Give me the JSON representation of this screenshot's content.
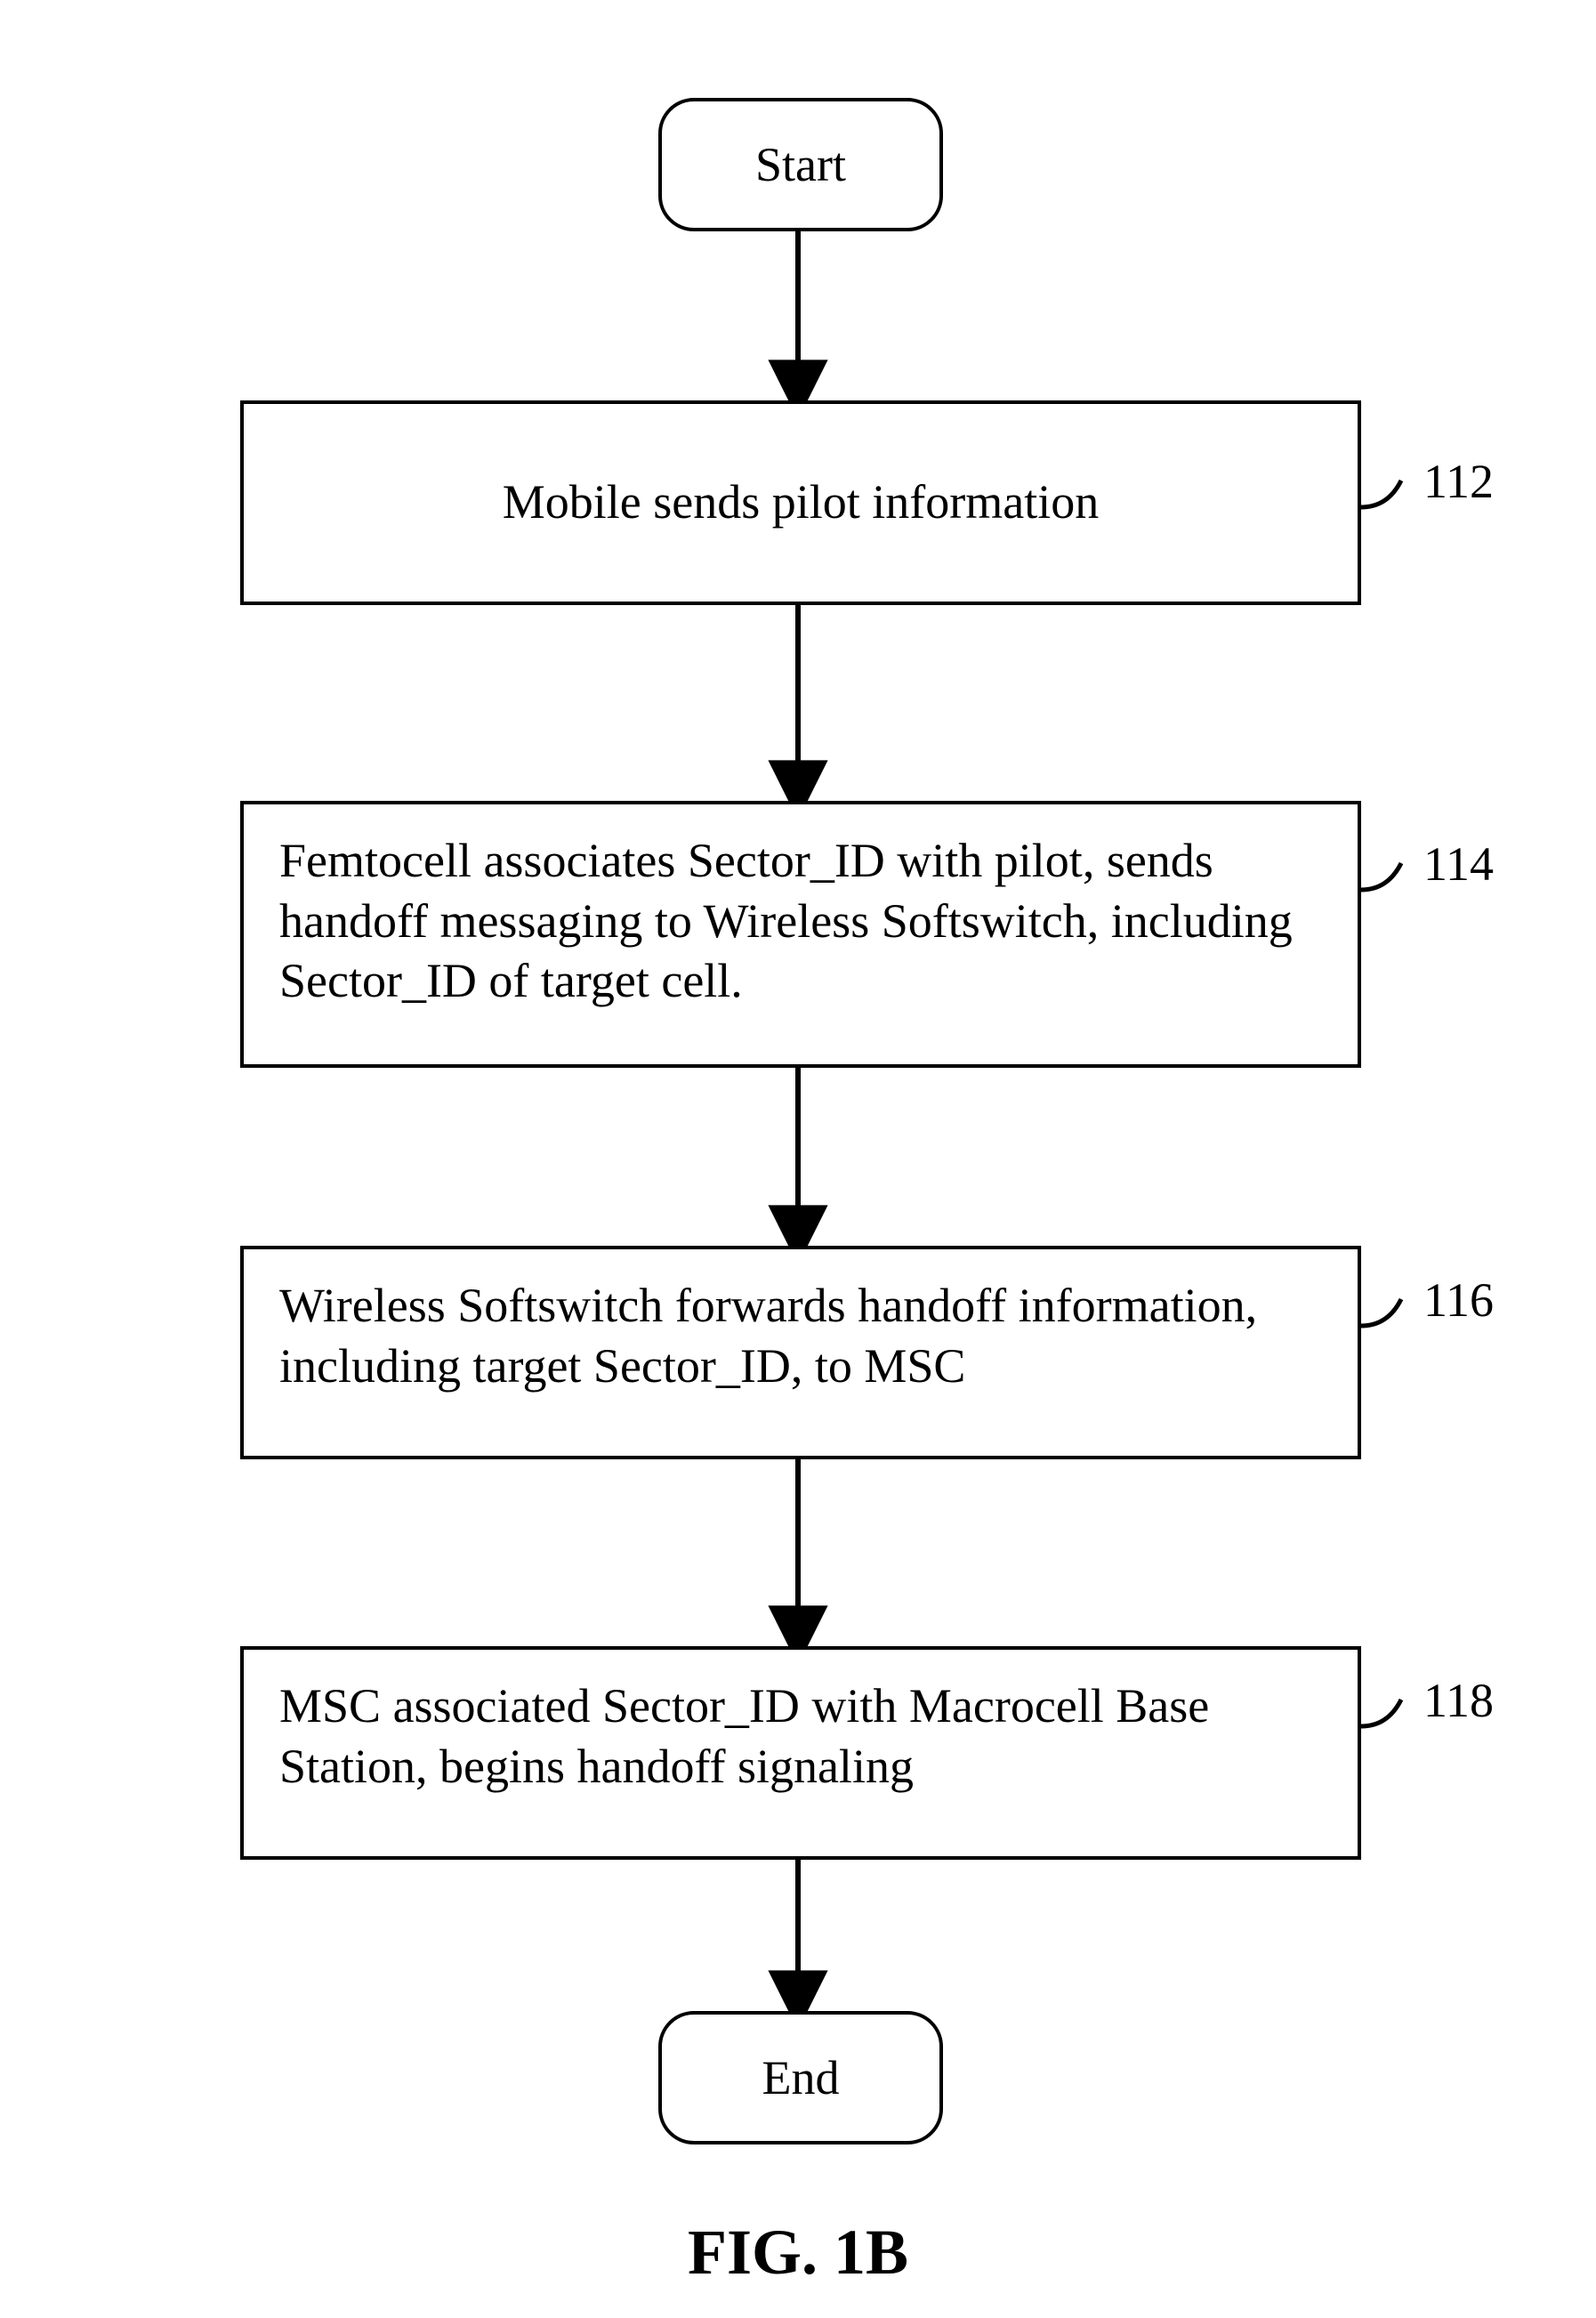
{
  "figure_caption": "FIG. 1B",
  "terminals": {
    "start": "Start",
    "end": "End"
  },
  "steps": {
    "s112": {
      "num": "112",
      "text": "Mobile sends pilot information"
    },
    "s114": {
      "num": "114",
      "text": "Femtocell associates Sector_ID with pilot, sends handoff messaging to Wireless Softswitch, including Sector_ID of target cell."
    },
    "s116": {
      "num": "116",
      "text": "Wireless Softswitch forwards handoff information, including target Sector_ID, to MSC"
    },
    "s118": {
      "num": "118",
      "text": "MSC associated Sector_ID with Macrocell Base Station, begins handoff signaling"
    }
  }
}
